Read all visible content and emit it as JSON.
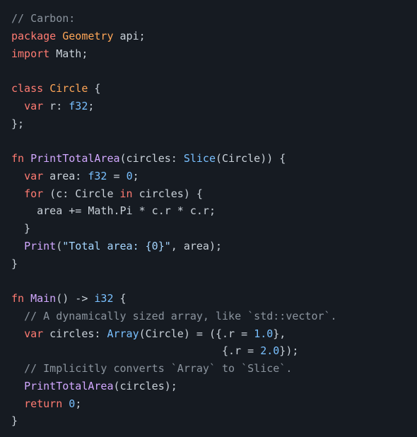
{
  "code": {
    "lines": [
      [
        {
          "t": "// Carbon:",
          "c": "c"
        }
      ],
      [
        {
          "t": "package",
          "c": "kw"
        },
        {
          "t": " ",
          "c": "pu"
        },
        {
          "t": "Geometry",
          "c": "ty"
        },
        {
          "t": " ",
          "c": "pu"
        },
        {
          "t": "api",
          "c": "id"
        },
        {
          "t": ";",
          "c": "pu"
        }
      ],
      [
        {
          "t": "import",
          "c": "kw"
        },
        {
          "t": " ",
          "c": "pu"
        },
        {
          "t": "Math",
          "c": "id"
        },
        {
          "t": ";",
          "c": "pu"
        }
      ],
      [],
      [
        {
          "t": "class",
          "c": "kw"
        },
        {
          "t": " ",
          "c": "pu"
        },
        {
          "t": "Circle",
          "c": "ty"
        },
        {
          "t": " {",
          "c": "pu"
        }
      ],
      [
        {
          "t": "  ",
          "c": "pu"
        },
        {
          "t": "var",
          "c": "kw"
        },
        {
          "t": " r: ",
          "c": "pu"
        },
        {
          "t": "f32",
          "c": "pr"
        },
        {
          "t": ";",
          "c": "pu"
        }
      ],
      [
        {
          "t": "};",
          "c": "pu"
        }
      ],
      [],
      [
        {
          "t": "fn",
          "c": "kw"
        },
        {
          "t": " ",
          "c": "pu"
        },
        {
          "t": "PrintTotalArea",
          "c": "fn"
        },
        {
          "t": "(circles: ",
          "c": "pu"
        },
        {
          "t": "Slice",
          "c": "pr"
        },
        {
          "t": "(Circle)) {",
          "c": "pu"
        }
      ],
      [
        {
          "t": "  ",
          "c": "pu"
        },
        {
          "t": "var",
          "c": "kw"
        },
        {
          "t": " area: ",
          "c": "pu"
        },
        {
          "t": "f32",
          "c": "pr"
        },
        {
          "t": " = ",
          "c": "pu"
        },
        {
          "t": "0",
          "c": "nu"
        },
        {
          "t": ";",
          "c": "pu"
        }
      ],
      [
        {
          "t": "  ",
          "c": "pu"
        },
        {
          "t": "for",
          "c": "kw"
        },
        {
          "t": " (c: Circle ",
          "c": "pu"
        },
        {
          "t": "in",
          "c": "kw"
        },
        {
          "t": " circles) {",
          "c": "pu"
        }
      ],
      [
        {
          "t": "    area += Math.Pi * c.r * c.r;",
          "c": "pu"
        }
      ],
      [
        {
          "t": "  }",
          "c": "pu"
        }
      ],
      [
        {
          "t": "  ",
          "c": "pu"
        },
        {
          "t": "Print",
          "c": "fn"
        },
        {
          "t": "(",
          "c": "pu"
        },
        {
          "t": "\"Total area: {0}\"",
          "c": "st"
        },
        {
          "t": ", area);",
          "c": "pu"
        }
      ],
      [
        {
          "t": "}",
          "c": "pu"
        }
      ],
      [],
      [
        {
          "t": "fn",
          "c": "kw"
        },
        {
          "t": " ",
          "c": "pu"
        },
        {
          "t": "Main",
          "c": "fn"
        },
        {
          "t": "() -> ",
          "c": "pu"
        },
        {
          "t": "i32",
          "c": "pr"
        },
        {
          "t": " {",
          "c": "pu"
        }
      ],
      [
        {
          "t": "  ",
          "c": "pu"
        },
        {
          "t": "// A dynamically sized array, like `std::vector`.",
          "c": "c"
        }
      ],
      [
        {
          "t": "  ",
          "c": "pu"
        },
        {
          "t": "var",
          "c": "kw"
        },
        {
          "t": " circles: ",
          "c": "pu"
        },
        {
          "t": "Array",
          "c": "pr"
        },
        {
          "t": "(Circle) = ({.r = ",
          "c": "pu"
        },
        {
          "t": "1.0",
          "c": "nu"
        },
        {
          "t": "},",
          "c": "pu"
        }
      ],
      [
        {
          "t": "                                 {.r = ",
          "c": "pu"
        },
        {
          "t": "2.0",
          "c": "nu"
        },
        {
          "t": "});",
          "c": "pu"
        }
      ],
      [
        {
          "t": "  ",
          "c": "pu"
        },
        {
          "t": "// Implicitly converts `Array` to `Slice`.",
          "c": "c"
        }
      ],
      [
        {
          "t": "  ",
          "c": "pu"
        },
        {
          "t": "PrintTotalArea",
          "c": "fn"
        },
        {
          "t": "(circles);",
          "c": "pu"
        }
      ],
      [
        {
          "t": "  ",
          "c": "pu"
        },
        {
          "t": "return",
          "c": "kw"
        },
        {
          "t": " ",
          "c": "pu"
        },
        {
          "t": "0",
          "c": "nu"
        },
        {
          "t": ";",
          "c": "pu"
        }
      ],
      [
        {
          "t": "}",
          "c": "pu"
        }
      ]
    ]
  }
}
